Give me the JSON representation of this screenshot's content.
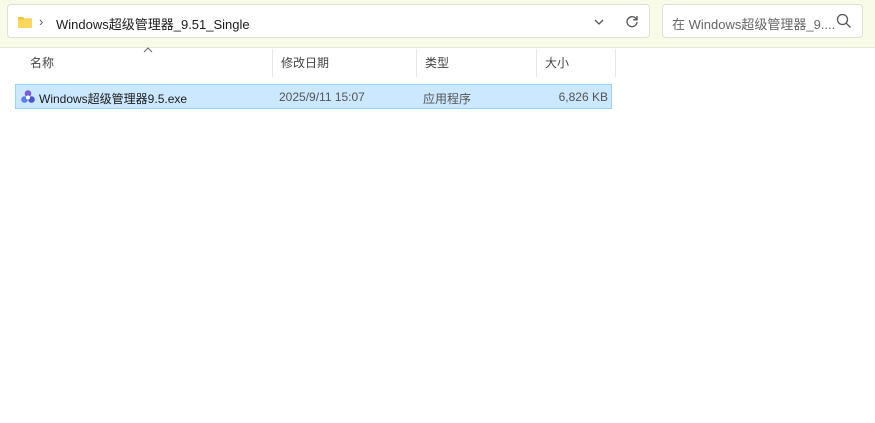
{
  "address_bar": {
    "path": "Windows超级管理器_9.51_Single",
    "separator": "›"
  },
  "search": {
    "placeholder": "在 Windows超级管理器_9...."
  },
  "columns": {
    "name": "名称",
    "date": "修改日期",
    "type": "类型",
    "size": "大小"
  },
  "files": [
    {
      "name": "Windows超级管理器9.5.exe",
      "date": "2025/9/11 15:07",
      "type": "应用程序",
      "size": "6,826 KB"
    }
  ],
  "colors": {
    "toolbar_bg": "#f9fbe9",
    "selection_bg": "#cce8ff",
    "selection_border": "#99d1ff",
    "folder_yellow": "#f4c63d"
  },
  "icons": {
    "folder": "folder-icon",
    "dropdown": "chevron-down-icon",
    "refresh": "refresh-icon",
    "search": "search-icon",
    "sort": "sort-up-icon",
    "app": "app-icon"
  }
}
